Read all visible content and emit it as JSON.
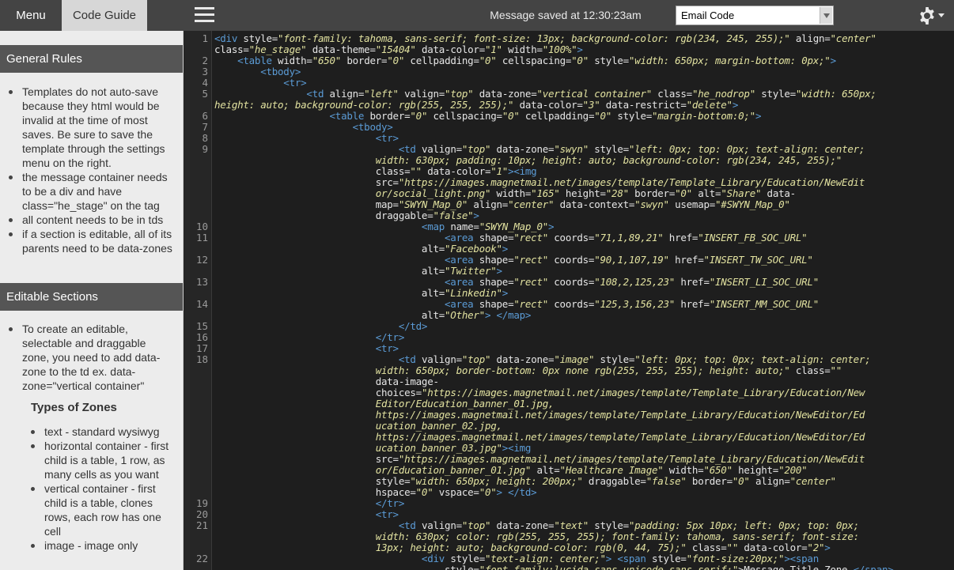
{
  "topbar": {
    "menu_label": "Menu",
    "guide_label": "Code Guide",
    "status": "Message saved at 12:30:23am",
    "select_value": "Email Code",
    "hamburger_icon": "hamburger-icon",
    "gear_icon": "gear-icon"
  },
  "sidebar": {
    "general_title": "General Rules",
    "general_items": [
      "Templates do not auto-save because they html would be invalid at the time of most saves. Be sure to save the template through the settings menu on the right.",
      "the message container needs to be a div and have class=\"he_stage\" on the tag",
      "all content needs to be in tds",
      "if a section is editable, all of its parents need to be data-zones"
    ],
    "editable_title": "Editable Sections",
    "editable_items": [
      "To create an editable, selectable and draggable zone, you need to add data-zone to the td ex. data-zone=\"vertical container\""
    ],
    "types_title": "Types of Zones",
    "types_items": [
      "text - standard wysiwyg",
      "horizontal container - first child is a table, 1 row, as many cells as you want",
      "vertical container - first child is a table, clones rows, each row has one cell",
      "image - image only"
    ]
  },
  "code": {
    "line_numbers": [
      "1",
      "2",
      "3",
      "4",
      "5",
      "6",
      "7",
      "8",
      "9",
      "10",
      "11",
      "12",
      "13",
      "14",
      "15",
      "16",
      "17",
      "18",
      "19",
      "20",
      "21",
      "22"
    ],
    "lines": [
      [
        [
          "t",
          "<div "
        ],
        [
          "a",
          "style="
        ],
        [
          "s",
          "\"font-family: tahoma, sans-serif; font-size: 13px; background-color: rgb(234, 245, 255);\""
        ],
        [
          "a",
          " align="
        ],
        [
          "s",
          "\"center\""
        ]
      ],
      [
        [
          "a",
          "class="
        ],
        [
          "s",
          "\"he_stage\""
        ],
        [
          "a",
          " data-theme="
        ],
        [
          "s",
          "\"15404\""
        ],
        [
          "a",
          " data-color="
        ],
        [
          "s",
          "\"1\""
        ],
        [
          "a",
          " width="
        ],
        [
          "s",
          "\"100%\""
        ],
        [
          "t",
          ">"
        ]
      ],
      [
        [
          "t",
          "    <table "
        ],
        [
          "a",
          "width="
        ],
        [
          "s",
          "\"650\""
        ],
        [
          "a",
          " border="
        ],
        [
          "s",
          "\"0\""
        ],
        [
          "a",
          " cellpadding="
        ],
        [
          "s",
          "\"0\""
        ],
        [
          "a",
          " cellspacing="
        ],
        [
          "s",
          "\"0\""
        ],
        [
          "a",
          " style="
        ],
        [
          "s",
          "\"width: 650px; margin-bottom: 0px;\""
        ],
        [
          "t",
          ">"
        ]
      ],
      [
        [
          "t",
          "        <tbody>"
        ]
      ],
      [
        [
          "t",
          "            <tr>"
        ]
      ],
      [
        [
          "t",
          "                <td "
        ],
        [
          "a",
          "align="
        ],
        [
          "s",
          "\"left\""
        ],
        [
          "a",
          " valign="
        ],
        [
          "s",
          "\"top\""
        ],
        [
          "a",
          " data-zone="
        ],
        [
          "s",
          "\"vertical container\""
        ],
        [
          "a",
          " class="
        ],
        [
          "s",
          "\"he_nodrop\""
        ],
        [
          "a",
          " style="
        ],
        [
          "s",
          "\"width: 650px;"
        ]
      ],
      [
        [
          "s",
          "height: auto; background-color: rgb(255, 255, 255);\""
        ],
        [
          "a",
          " data-color="
        ],
        [
          "s",
          "\"3\""
        ],
        [
          "a",
          " data-restrict="
        ],
        [
          "s",
          "\"delete\""
        ],
        [
          "t",
          ">"
        ]
      ],
      [
        [
          "t",
          "                    <table "
        ],
        [
          "a",
          "border="
        ],
        [
          "s",
          "\"0\""
        ],
        [
          "a",
          " cellspacing="
        ],
        [
          "s",
          "\"0\""
        ],
        [
          "a",
          " cellpadding="
        ],
        [
          "s",
          "\"0\""
        ],
        [
          "a",
          " style="
        ],
        [
          "s",
          "\"margin-bottom:0;\""
        ],
        [
          "t",
          ">"
        ]
      ],
      [
        [
          "t",
          "                        <tbody>"
        ]
      ],
      [
        [
          "t",
          "                            <tr>"
        ]
      ],
      [
        [
          "t",
          "                                <td "
        ],
        [
          "a",
          "valign="
        ],
        [
          "s",
          "\"top\""
        ],
        [
          "a",
          " data-zone="
        ],
        [
          "s",
          "\"swyn\""
        ],
        [
          "a",
          " style="
        ],
        [
          "s",
          "\"left: 0px; top: 0px; text-align: center;"
        ]
      ],
      [
        [
          "s",
          "                            width: 630px; padding: 10px; height: auto; background-color: rgb(234, 245, 255);\""
        ]
      ],
      [
        [
          "a",
          "                            class="
        ],
        [
          "s",
          "\"\""
        ],
        [
          "a",
          " data-color="
        ],
        [
          "s",
          "\"1\""
        ],
        [
          "t",
          "><img"
        ]
      ],
      [
        [
          "a",
          "                            src="
        ],
        [
          "s",
          "\"https://images.magnetmail.net/images/template/Template_Library/Education/NewEdit"
        ]
      ],
      [
        [
          "s",
          "                            or/social_light.png\""
        ],
        [
          "a",
          " width="
        ],
        [
          "s",
          "\"165\""
        ],
        [
          "a",
          " height="
        ],
        [
          "s",
          "\"28\""
        ],
        [
          "a",
          " border="
        ],
        [
          "s",
          "\"0\""
        ],
        [
          "a",
          " alt="
        ],
        [
          "s",
          "\"Share\""
        ],
        [
          "a",
          " data-"
        ]
      ],
      [
        [
          "a",
          "                            map="
        ],
        [
          "s",
          "\"SWYN_Map_0\""
        ],
        [
          "a",
          " align="
        ],
        [
          "s",
          "\"center\""
        ],
        [
          "a",
          " data-context="
        ],
        [
          "s",
          "\"swyn\""
        ],
        [
          "a",
          " usemap="
        ],
        [
          "s",
          "\"#SWYN_Map_0\""
        ]
      ],
      [
        [
          "a",
          "                            draggable="
        ],
        [
          "s",
          "\"false\""
        ],
        [
          "t",
          ">"
        ]
      ],
      [
        [
          "t",
          "                                    <map "
        ],
        [
          "a",
          "name="
        ],
        [
          "s",
          "\"SWYN_Map_0\""
        ],
        [
          "t",
          ">"
        ]
      ],
      [
        [
          "t",
          "                                        <area "
        ],
        [
          "a",
          "shape="
        ],
        [
          "s",
          "\"rect\""
        ],
        [
          "a",
          " coords="
        ],
        [
          "s",
          "\"71,1,89,21\""
        ],
        [
          "a",
          " href="
        ],
        [
          "s",
          "\"INSERT_FB_SOC_URL\""
        ]
      ],
      [
        [
          "a",
          "                                    alt="
        ],
        [
          "s",
          "\"Facebook\""
        ],
        [
          "t",
          ">"
        ]
      ],
      [
        [
          "t",
          "                                        <area "
        ],
        [
          "a",
          "shape="
        ],
        [
          "s",
          "\"rect\""
        ],
        [
          "a",
          " coords="
        ],
        [
          "s",
          "\"90,1,107,19\""
        ],
        [
          "a",
          " href="
        ],
        [
          "s",
          "\"INSERT_TW_SOC_URL\""
        ]
      ],
      [
        [
          "a",
          "                                    alt="
        ],
        [
          "s",
          "\"Twitter\""
        ],
        [
          "t",
          ">"
        ]
      ],
      [
        [
          "t",
          "                                        <area "
        ],
        [
          "a",
          "shape="
        ],
        [
          "s",
          "\"rect\""
        ],
        [
          "a",
          " coords="
        ],
        [
          "s",
          "\"108,2,125,23\""
        ],
        [
          "a",
          " href="
        ],
        [
          "s",
          "\"INSERT_LI_SOC_URL\""
        ]
      ],
      [
        [
          "a",
          "                                    alt="
        ],
        [
          "s",
          "\"Linkedin\""
        ],
        [
          "t",
          ">"
        ]
      ],
      [
        [
          "t",
          "                                        <area "
        ],
        [
          "a",
          "shape="
        ],
        [
          "s",
          "\"rect\""
        ],
        [
          "a",
          " coords="
        ],
        [
          "s",
          "\"125,3,156,23\""
        ],
        [
          "a",
          " href="
        ],
        [
          "s",
          "\"INSERT_MM_SOC_URL\""
        ]
      ],
      [
        [
          "a",
          "                                    alt="
        ],
        [
          "s",
          "\"Other\""
        ],
        [
          "t",
          "> </map>"
        ]
      ],
      [
        [
          "t",
          "                                </td>"
        ]
      ],
      [
        [
          "t",
          "                            </tr>"
        ]
      ],
      [
        [
          "t",
          "                            <tr>"
        ]
      ],
      [
        [
          "t",
          "                                <td "
        ],
        [
          "a",
          "valign="
        ],
        [
          "s",
          "\"top\""
        ],
        [
          "a",
          " data-zone="
        ],
        [
          "s",
          "\"image\""
        ],
        [
          "a",
          " style="
        ],
        [
          "s",
          "\"left: 0px; top: 0px; text-align: center;"
        ]
      ],
      [
        [
          "s",
          "                            width: 650px; border-bottom: 0px none rgb(255, 255, 255); height: auto;\""
        ],
        [
          "a",
          " class="
        ],
        [
          "s",
          "\"\""
        ]
      ],
      [
        [
          "a",
          "                            data-image-"
        ]
      ],
      [
        [
          "a",
          "                            choices="
        ],
        [
          "s",
          "\"https://images.magnetmail.net/images/template/Template_Library/Education/New"
        ]
      ],
      [
        [
          "s",
          "                            Editor/Education_banner_01.jpg,"
        ]
      ],
      [
        [
          "s",
          "                            https://images.magnetmail.net/images/template/Template_Library/Education/NewEditor/Ed"
        ]
      ],
      [
        [
          "s",
          "                            ucation_banner_02.jpg,"
        ]
      ],
      [
        [
          "s",
          "                            https://images.magnetmail.net/images/template/Template_Library/Education/NewEditor/Ed"
        ]
      ],
      [
        [
          "s",
          "                            ucation_banner_03.jpg\""
        ],
        [
          "t",
          "><img"
        ]
      ],
      [
        [
          "a",
          "                            src="
        ],
        [
          "s",
          "\"https://images.magnetmail.net/images/template/Template_Library/Education/NewEdit"
        ]
      ],
      [
        [
          "s",
          "                            or/Education_banner_01.jpg\""
        ],
        [
          "a",
          " alt="
        ],
        [
          "s",
          "\"Healthcare Image\""
        ],
        [
          "a",
          " width="
        ],
        [
          "s",
          "\"650\""
        ],
        [
          "a",
          " height="
        ],
        [
          "s",
          "\"200\""
        ]
      ],
      [
        [
          "a",
          "                            style="
        ],
        [
          "s",
          "\"width: 650px; height: 200px;\""
        ],
        [
          "a",
          " draggable="
        ],
        [
          "s",
          "\"false\""
        ],
        [
          "a",
          " border="
        ],
        [
          "s",
          "\"0\""
        ],
        [
          "a",
          " align="
        ],
        [
          "s",
          "\"center\""
        ]
      ],
      [
        [
          "a",
          "                            hspace="
        ],
        [
          "s",
          "\"0\""
        ],
        [
          "a",
          " vspace="
        ],
        [
          "s",
          "\"0\""
        ],
        [
          "t",
          "> </td>"
        ]
      ],
      [
        [
          "t",
          "                            </tr>"
        ]
      ],
      [
        [
          "t",
          "                            <tr>"
        ]
      ],
      [
        [
          "t",
          "                                <td "
        ],
        [
          "a",
          "valign="
        ],
        [
          "s",
          "\"top\""
        ],
        [
          "a",
          " data-zone="
        ],
        [
          "s",
          "\"text\""
        ],
        [
          "a",
          " style="
        ],
        [
          "s",
          "\"padding: 5px 10px; left: 0px; top: 0px;"
        ]
      ],
      [
        [
          "s",
          "                            width: 630px; color: rgb(255, 255, 255); font-family: tahoma, sans-serif; font-size:"
        ]
      ],
      [
        [
          "s",
          "                            13px; height: auto; background-color: rgb(0, 44, 75);\""
        ],
        [
          "a",
          " class="
        ],
        [
          "s",
          "\"\""
        ],
        [
          "a",
          " data-color="
        ],
        [
          "s",
          "\"2\""
        ],
        [
          "t",
          ">"
        ]
      ],
      [
        [
          "t",
          "                                    <div "
        ],
        [
          "a",
          "style="
        ],
        [
          "s",
          "\"text-align: center;\""
        ],
        [
          "t",
          "> <span "
        ],
        [
          "a",
          "style="
        ],
        [
          "s",
          "\"font-size:20px;\""
        ],
        [
          "t",
          "><span"
        ]
      ],
      [
        [
          "a",
          "                                        style="
        ],
        [
          "s",
          "\"font-family:lucida sans unicode,sans-serif;\""
        ],
        [
          "p",
          ">Message Title Zone "
        ],
        [
          "t",
          "</span>"
        ]
      ]
    ]
  }
}
